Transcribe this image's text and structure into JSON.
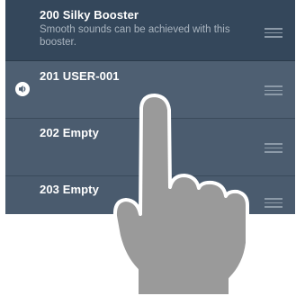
{
  "list": {
    "items": [
      {
        "title": "200 Silky Booster",
        "description": "Smooth sounds can be achieved with this booster."
      },
      {
        "title": "201 USER-001",
        "playing": true
      },
      {
        "title": "202 Empty"
      },
      {
        "title": "203 Empty"
      }
    ]
  },
  "icons": {
    "speaker": "speaker-icon",
    "reorder": "reorder-handle-icon",
    "hand": "pointing-hand-icon"
  },
  "colors": {
    "selected_row": "#34475b",
    "row": "#4b5c6f",
    "title_text": "#ffffff",
    "description_text": "#a9b4bf",
    "hand": "#9a9a9a"
  }
}
